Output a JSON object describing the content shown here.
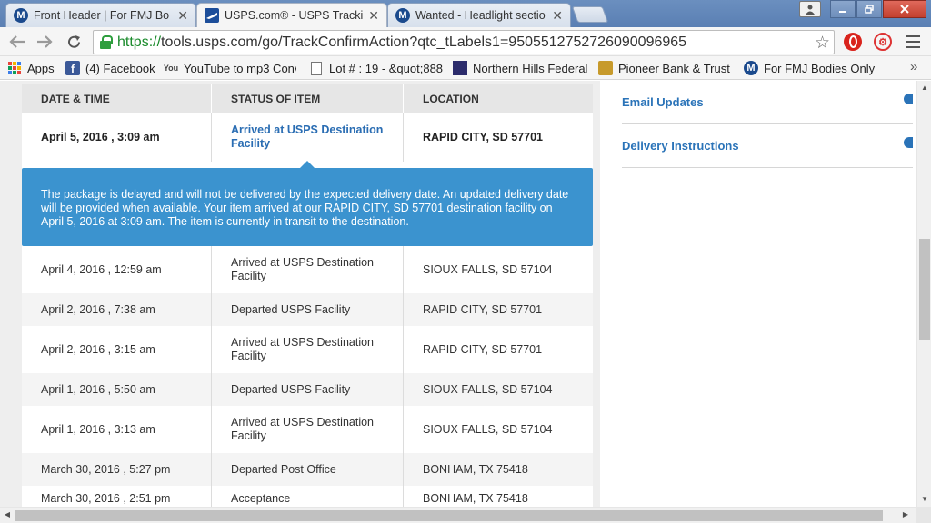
{
  "tabs": [
    {
      "title": "Front Header | For FMJ Bo",
      "icon": "mopar-icon",
      "active": false
    },
    {
      "title": "USPS.com® - USPS Tracki",
      "icon": "usps-icon",
      "active": true
    },
    {
      "title": "Wanted - Headlight sectio",
      "icon": "mopar-icon",
      "active": false
    }
  ],
  "toolbar": {
    "url_scheme": "https://",
    "url_rest": "tools.usps.com/go/TrackConfirmAction?qtc_tLabels1=9505512752726090096965"
  },
  "bookmarks": [
    {
      "label": "Apps",
      "icon": "apps-grid-icon"
    },
    {
      "label": "(4) Facebook",
      "icon": "facebook-icon"
    },
    {
      "label": "YouTube to mp3 Conv",
      "icon": "youtube-mp3-icon"
    },
    {
      "label": "Lot # : 19 - &quot;888",
      "icon": "page-icon"
    },
    {
      "label": "Northern Hills Federal",
      "icon": "northern-hills-icon"
    },
    {
      "label": "Pioneer Bank & Trust",
      "icon": "pioneer-bank-icon"
    },
    {
      "label": "For FMJ Bodies Only",
      "icon": "mopar-icon"
    }
  ],
  "table": {
    "headers": [
      "DATE & TIME",
      "STATUS OF ITEM",
      "LOCATION"
    ],
    "latest": {
      "date": "April 5, 2016 , 3:09 am",
      "status": "Arrived at USPS Destination Facility",
      "location": "RAPID CITY, SD 57701"
    },
    "alert": "The package is delayed and will not be delivered by the expected delivery date. An updated delivery date will be provided when available. Your item arrived at our RAPID CITY, SD 57701 destination facility on April 5, 2016 at 3:09 am. The item is currently in transit to the destination.",
    "rows": [
      {
        "date": "April 4, 2016 , 12:59 am",
        "status": "Arrived at USPS Destination Facility",
        "location": "SIOUX FALLS, SD 57104"
      },
      {
        "date": "April 2, 2016 , 7:38 am",
        "status": "Departed USPS Facility",
        "location": "RAPID CITY, SD 57701"
      },
      {
        "date": "April 2, 2016 , 3:15 am",
        "status": "Arrived at USPS Destination Facility",
        "location": "RAPID CITY, SD 57701"
      },
      {
        "date": "April 1, 2016 , 5:50 am",
        "status": "Departed USPS Facility",
        "location": "SIOUX FALLS, SD 57104"
      },
      {
        "date": "April 1, 2016 , 3:13 am",
        "status": "Arrived at USPS Destination Facility",
        "location": "SIOUX FALLS, SD 57104"
      },
      {
        "date": "March 30, 2016 , 5:27 pm",
        "status": "Departed Post Office",
        "location": "BONHAM, TX 75418"
      },
      {
        "date": "March 30, 2016 , 2:51 pm",
        "status": "Acceptance",
        "location": "BONHAM, TX 75418"
      }
    ]
  },
  "sidebar": {
    "links": [
      "Email Updates",
      "Delivery Instructions"
    ]
  },
  "colors": {
    "alert_bg": "#3b93cf",
    "link_blue": "#2a73b8",
    "url_green": "#1b8b2c"
  }
}
